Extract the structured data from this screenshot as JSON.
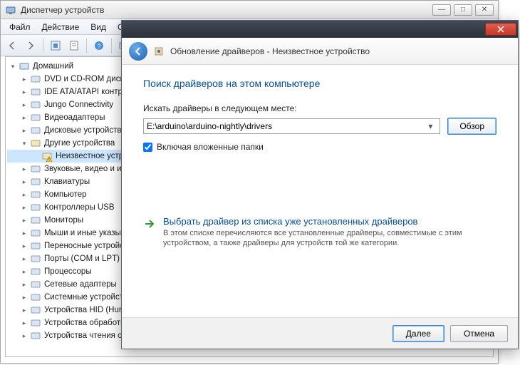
{
  "device_manager": {
    "title": "Диспетчер устройств",
    "menu": [
      "Файл",
      "Действие",
      "Вид",
      "Справка"
    ],
    "root": "Домашний",
    "categories": [
      "DVD и CD-ROM диско",
      "IDE ATA/ATAPI контр",
      "Jungo Connectivity",
      "Видеоадаптеры",
      "Дисковые устройств",
      "Другие устройства",
      "Звуковые, видео и иг",
      "Клавиатуры",
      "Компьютер",
      "Контроллеры USB",
      "Мониторы",
      "Мыши и иные указыв",
      "Переносные устройс",
      "Порты (COM и LPT)",
      "Процессоры",
      "Сетевые адаптеры",
      "Системные устройст",
      "Устройства HID (Hum",
      "Устройства обработк",
      "Устройства чтения см"
    ],
    "unknown_device": "Неизвестное устр",
    "other_devices_index": 5
  },
  "wizard": {
    "title": "Обновление драйверов - Неизвестное устройство",
    "heading": "Поиск драйверов на этом компьютере",
    "path_label": "Искать драйверы в следующем месте:",
    "path_value": "E:\\arduino\\arduino-nightly\\drivers",
    "browse": "Обзор",
    "include_subfolders": "Включая вложенные папки",
    "include_subfolders_checked": true,
    "pick_title": "Выбрать драйвер из списка уже установленных драйверов",
    "pick_desc": "В этом списке перечисляются все установленные драйверы, совместимые с этим устройством, а также драйверы для устройств той же категории.",
    "next": "Далее",
    "cancel": "Отмена"
  }
}
